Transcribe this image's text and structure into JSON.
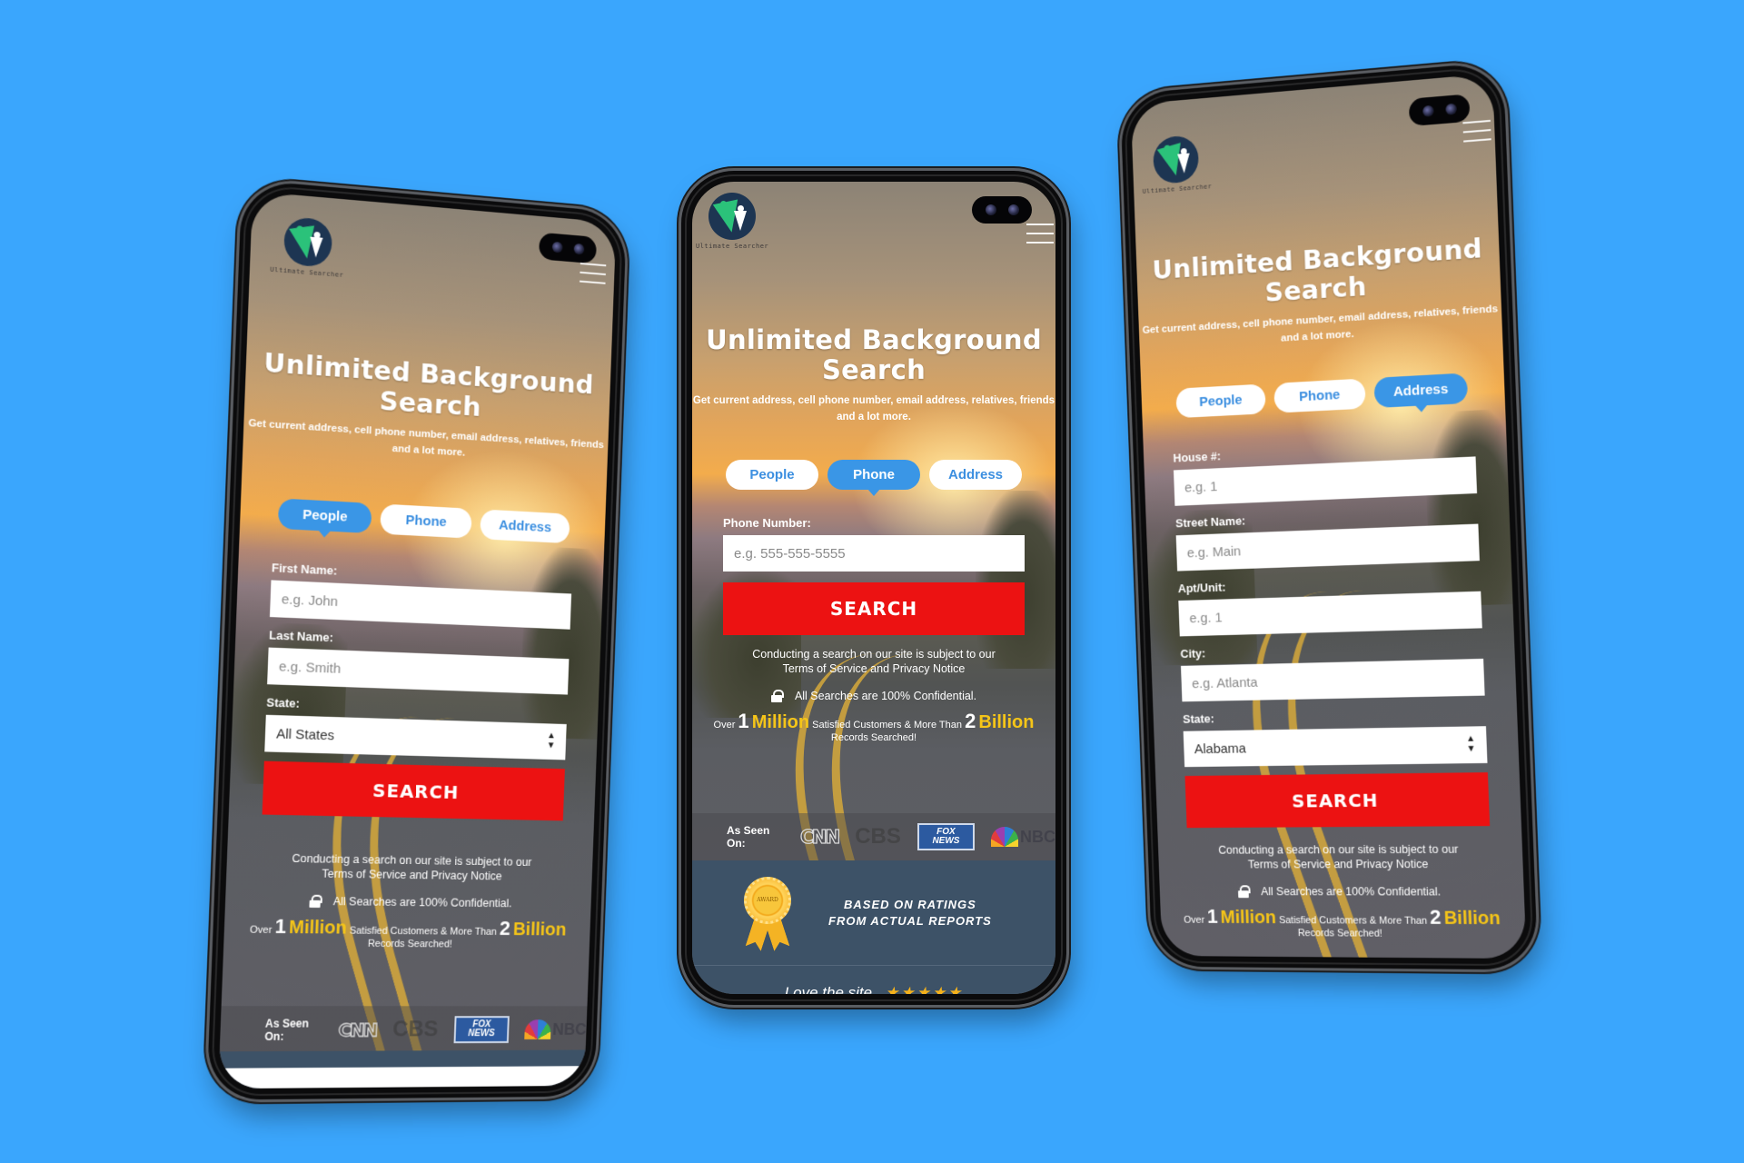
{
  "background_color": "#3aa6fd",
  "colors": {
    "tab_active": "#3a96e6",
    "tab_text": "#3c8fe0",
    "search_button": "#ec1212",
    "highlight_gold": "#f5c518",
    "award_panel": "#3d5267"
  },
  "brand": {
    "logo_text": "Ultimate Searcher",
    "logo_icon": "person-check-logo-icon",
    "menu_icon": "hamburger-menu-icon"
  },
  "hero": {
    "title_line1": "Unlimited Background",
    "title_line2": "Search",
    "subtitle_line1": "Get current address, cell phone number, email address, relatives, friends",
    "subtitle_line2": "and a lot more."
  },
  "tabs": [
    {
      "label": "People"
    },
    {
      "label": "Phone"
    },
    {
      "label": "Address"
    }
  ],
  "phones": {
    "people": {
      "active_tab": "People",
      "fields": [
        {
          "label": "First Name:",
          "placeholder": "e.g. John",
          "value": ""
        },
        {
          "label": "Last Name:",
          "placeholder": "e.g. Smith",
          "value": ""
        }
      ],
      "state_label": "State:",
      "state_value": "All States"
    },
    "phone": {
      "active_tab": "Phone",
      "fields": [
        {
          "label": "Phone Number:",
          "placeholder": "e.g. 555-555-5555",
          "value": ""
        }
      ]
    },
    "address": {
      "active_tab": "Address",
      "fields": [
        {
          "label": "House #:",
          "placeholder": "e.g. 1",
          "value": ""
        },
        {
          "label": "Street Name:",
          "placeholder": "e.g. Main",
          "value": ""
        },
        {
          "label": "Apt/Unit:",
          "placeholder": "e.g. 1",
          "value": ""
        },
        {
          "label": "City:",
          "placeholder": "e.g. Atlanta",
          "value": ""
        }
      ],
      "state_label": "State:",
      "state_value": "Alabama"
    }
  },
  "search_button_label": "SEARCH",
  "legal": {
    "line1": "Conducting a search on our site is subject to our",
    "line2": "Terms of Service and Privacy Notice",
    "confidential": "All Searches are 100% Confidential."
  },
  "stats": {
    "prefix": "Over",
    "customers_number": "1",
    "customers_unit": "Million",
    "middle": "Satisfied Customers & More Than",
    "records_number": "2",
    "records_unit": "Billion",
    "suffix": "Records Searched!"
  },
  "seen_on": {
    "label": "As Seen On:",
    "brands": [
      "CNN",
      "CBS",
      "FOX NEWS",
      "NBC"
    ]
  },
  "award": {
    "badge_text": "AWARD",
    "line1": "BASED ON RATINGS",
    "line2": "FROM ACTUAL REPORTS"
  },
  "review": {
    "text": "Love the site",
    "stars": "★★★★★",
    "rating": 5
  }
}
